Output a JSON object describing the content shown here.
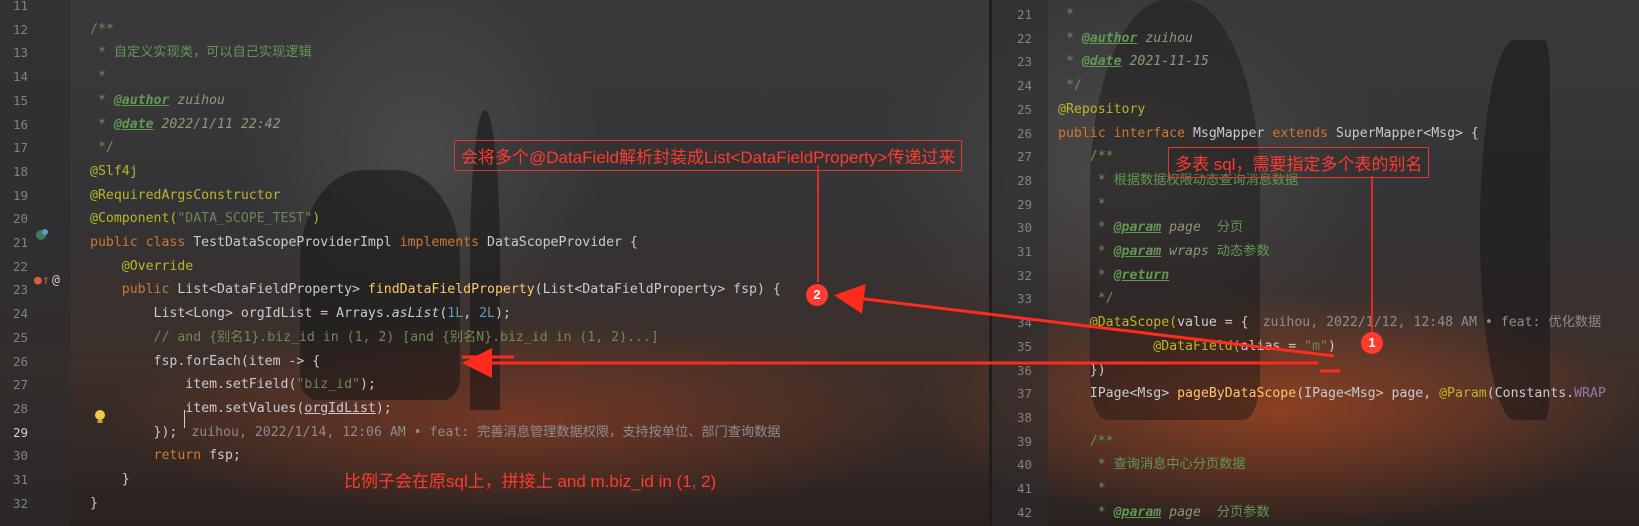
{
  "left_editor": {
    "lines": [
      {
        "n": "11",
        "segs": [
          {
            "t": "",
            "c": ""
          }
        ]
      },
      {
        "n": "12",
        "segs": [
          {
            "t": "/**",
            "c": "cmt"
          }
        ]
      },
      {
        "n": "13",
        "segs": [
          {
            "t": " * 自定义实现类，可以自己实现逻辑",
            "c": "doc"
          }
        ]
      },
      {
        "n": "14",
        "segs": [
          {
            "t": " *",
            "c": "doc"
          }
        ]
      },
      {
        "n": "15",
        "segs": [
          {
            "t": " * ",
            "c": "doc"
          },
          {
            "t": "@author",
            "c": "doctag"
          },
          {
            "t": " zuihou",
            "c": "docv"
          }
        ]
      },
      {
        "n": "16",
        "segs": [
          {
            "t": " * ",
            "c": "doc"
          },
          {
            "t": "@date",
            "c": "doctag"
          },
          {
            "t": " 2022/1/11 22:42",
            "c": "docv"
          }
        ]
      },
      {
        "n": "17",
        "segs": [
          {
            "t": " */",
            "c": "doc"
          }
        ]
      },
      {
        "n": "18",
        "segs": [
          {
            "t": "@Slf4j",
            "c": "ann"
          }
        ]
      },
      {
        "n": "19",
        "segs": [
          {
            "t": "@RequiredArgsConstructor",
            "c": "ann"
          }
        ]
      },
      {
        "n": "20",
        "segs": [
          {
            "t": "@Component(",
            "c": "ann"
          },
          {
            "t": "\"DATA_SCOPE_TEST\"",
            "c": "str"
          },
          {
            "t": ")",
            "c": "ann"
          }
        ]
      },
      {
        "n": "21",
        "segs": [
          {
            "t": "public class ",
            "c": "kw"
          },
          {
            "t": "TestDataScopeProviderImpl ",
            "c": ""
          },
          {
            "t": "implements ",
            "c": "kw"
          },
          {
            "t": "DataScopeProvider {",
            "c": ""
          }
        ]
      },
      {
        "n": "22",
        "segs": [
          {
            "t": "    @Override",
            "c": "ann"
          }
        ]
      },
      {
        "n": "23",
        "segs": [
          {
            "t": "    public ",
            "c": "kw"
          },
          {
            "t": "List<DataFieldProperty> ",
            "c": ""
          },
          {
            "t": "findDataFieldProperty",
            "c": "fn"
          },
          {
            "t": "(List<DataFieldProperty> fsp) {",
            "c": ""
          }
        ]
      },
      {
        "n": "24",
        "segs": [
          {
            "t": "        List<Long> orgIdList = Arrays.",
            "c": ""
          },
          {
            "t": "asList",
            "c": "it"
          },
          {
            "t": "(",
            "c": ""
          },
          {
            "t": "1L",
            "c": "num"
          },
          {
            "t": ", ",
            "c": ""
          },
          {
            "t": "2L",
            "c": "num"
          },
          {
            "t": ");",
            "c": ""
          }
        ]
      },
      {
        "n": "25",
        "segs": [
          {
            "t": "        // and {别名1}.biz_id in (1, 2) [and {别名N}.biz_id in (1, 2)...]",
            "c": "cmt"
          }
        ]
      },
      {
        "n": "26",
        "segs": [
          {
            "t": "        fsp.forEach(item -> {",
            "c": ""
          }
        ]
      },
      {
        "n": "27",
        "segs": [
          {
            "t": "            item.setField(",
            "c": ""
          },
          {
            "t": "\"biz_id\"",
            "c": "str"
          },
          {
            "t": ");",
            "c": ""
          }
        ]
      },
      {
        "n": "28",
        "segs": [
          {
            "t": "            item.setValues(",
            "c": ""
          },
          {
            "t": "orgIdList",
            "c": "ul"
          },
          {
            "t": ");",
            "c": ""
          }
        ]
      },
      {
        "n": "29",
        "segs": [
          {
            "t": "        });",
            "c": ""
          }
        ],
        "blame": "zuihou, 2022/1/14, 12:06 AM • feat: 完善消息管理数据权限，支持按单位、部门查询数据"
      },
      {
        "n": "30",
        "segs": [
          {
            "t": "        ",
            "c": ""
          },
          {
            "t": "return ",
            "c": "kw"
          },
          {
            "t": "fsp;",
            "c": ""
          }
        ]
      },
      {
        "n": "31",
        "segs": [
          {
            "t": "    }",
            "c": ""
          }
        ]
      },
      {
        "n": "32",
        "segs": [
          {
            "t": "}",
            "c": ""
          }
        ]
      }
    ]
  },
  "right_editor": {
    "lines": [
      {
        "n": "21",
        "segs": [
          {
            "t": " *",
            "c": "doc"
          }
        ]
      },
      {
        "n": "22",
        "segs": [
          {
            "t": " * ",
            "c": "doc"
          },
          {
            "t": "@author",
            "c": "doctag"
          },
          {
            "t": " zuihou",
            "c": "docv"
          }
        ]
      },
      {
        "n": "23",
        "segs": [
          {
            "t": " * ",
            "c": "doc"
          },
          {
            "t": "@date",
            "c": "doctag"
          },
          {
            "t": " 2021-11-15",
            "c": "docv"
          }
        ]
      },
      {
        "n": "24",
        "segs": [
          {
            "t": " */",
            "c": "doc"
          }
        ]
      },
      {
        "n": "25",
        "segs": [
          {
            "t": "@Repository",
            "c": "ann"
          }
        ]
      },
      {
        "n": "26",
        "segs": [
          {
            "t": "public interface ",
            "c": "kw"
          },
          {
            "t": "MsgMapper ",
            "c": ""
          },
          {
            "t": "extends ",
            "c": "kw"
          },
          {
            "t": "SuperMapper<Msg> {",
            "c": ""
          }
        ]
      },
      {
        "n": "27",
        "segs": [
          {
            "t": "    /**",
            "c": "doc"
          }
        ]
      },
      {
        "n": "28",
        "segs": [
          {
            "t": "     * 根据数据权限动态查询消息数据",
            "c": "doc"
          }
        ]
      },
      {
        "n": "29",
        "segs": [
          {
            "t": "     *",
            "c": "doc"
          }
        ]
      },
      {
        "n": "30",
        "segs": [
          {
            "t": "     * ",
            "c": "doc"
          },
          {
            "t": "@param",
            "c": "doctag"
          },
          {
            "t": " page ",
            "c": "docv"
          },
          {
            "t": " 分页",
            "c": "doc"
          }
        ]
      },
      {
        "n": "31",
        "segs": [
          {
            "t": "     * ",
            "c": "doc"
          },
          {
            "t": "@param",
            "c": "doctag"
          },
          {
            "t": " wraps",
            "c": "docv"
          },
          {
            "t": " 动态参数",
            "c": "doc"
          }
        ]
      },
      {
        "n": "32",
        "segs": [
          {
            "t": "     * ",
            "c": "doc"
          },
          {
            "t": "@return",
            "c": "doctag"
          }
        ]
      },
      {
        "n": "33",
        "segs": [
          {
            "t": "     */",
            "c": "doc"
          }
        ]
      },
      {
        "n": "34",
        "segs": [
          {
            "t": "    @DataScope(",
            "c": "ann"
          },
          {
            "t": "value = {",
            "c": ""
          }
        ],
        "blame": "zuihou, 2022/1/12, 12:48 AM • feat: 优化数据"
      },
      {
        "n": "35",
        "segs": [
          {
            "t": "            @DataField(",
            "c": "ann"
          },
          {
            "t": "alias = ",
            "c": ""
          },
          {
            "t": "\"m\"",
            "c": "str"
          },
          {
            "t": ")",
            "c": ""
          }
        ]
      },
      {
        "n": "36",
        "segs": [
          {
            "t": "    })",
            "c": ""
          }
        ]
      },
      {
        "n": "37",
        "segs": [
          {
            "t": "    IPage<Msg> ",
            "c": ""
          },
          {
            "t": "pageByDataScope",
            "c": "fn"
          },
          {
            "t": "(IPage<Msg> page, ",
            "c": ""
          },
          {
            "t": "@Param",
            "c": "ann"
          },
          {
            "t": "(Constants.",
            "c": ""
          },
          {
            "t": "WRAP",
            "c": "field"
          }
        ]
      },
      {
        "n": "38",
        "segs": [
          {
            "t": "",
            "c": ""
          }
        ]
      },
      {
        "n": "39",
        "segs": [
          {
            "t": "    /**",
            "c": "doc"
          }
        ]
      },
      {
        "n": "40",
        "segs": [
          {
            "t": "     * 查询消息中心分页数据",
            "c": "doc"
          }
        ]
      },
      {
        "n": "41",
        "segs": [
          {
            "t": "     *",
            "c": "doc"
          }
        ]
      },
      {
        "n": "42",
        "segs": [
          {
            "t": "     * ",
            "c": "doc"
          },
          {
            "t": "@param",
            "c": "doctag"
          },
          {
            "t": " page ",
            "c": "docv"
          },
          {
            "t": " 分页参数",
            "c": "doc"
          }
        ]
      }
    ]
  },
  "annotations": {
    "callout_top": "会将多个@DataField解析封装成List<DataFieldProperty>传递过来",
    "callout_right": "多表 sql，需要指定多个表的别名",
    "note_bottom": "比例子会在原sql上，拼接上   and m.biz_id in (1, 2)",
    "badge_1": "1",
    "badge_2": "2"
  },
  "colors": {
    "annotation_red": "#ff3b30",
    "keyword": "#cc7832",
    "annotation": "#bbb529",
    "string": "#6a8759",
    "number": "#6897bb",
    "method": "#ffc66d"
  }
}
